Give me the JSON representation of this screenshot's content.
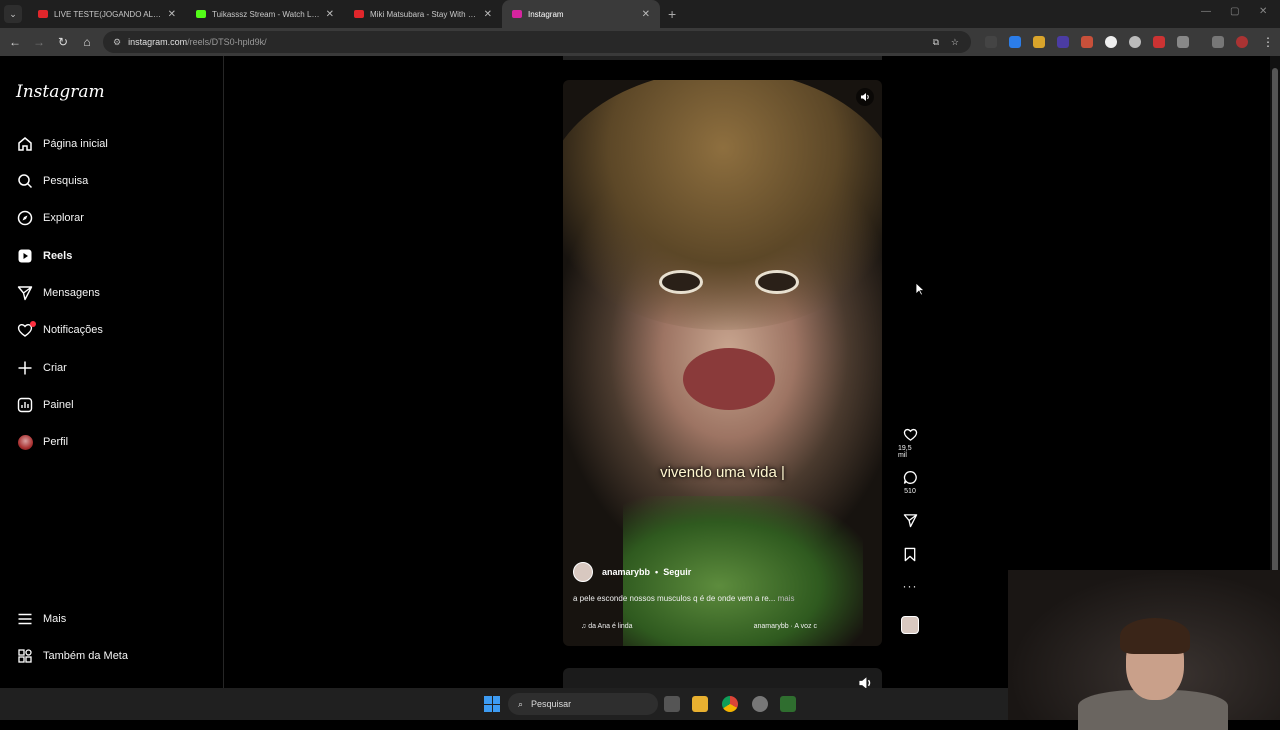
{
  "browser": {
    "tabs": [
      {
        "title": "LIVE TESTE(JOGANDO ALGO) -",
        "favicon_color": "#e0262b",
        "active": false
      },
      {
        "title": "Tuikasssz Stream - Watch Live o",
        "favicon_color": "#53fc18",
        "active": false
      },
      {
        "title": "Miki Matsubara - Stay With Me",
        "favicon_color": "#e0262b",
        "active": false
      },
      {
        "title": "Instagram",
        "favicon_color": "#d6249f",
        "active": true
      }
    ],
    "close_glyph": "✕",
    "new_tab_glyph": "+",
    "url_host": "instagram.com",
    "url_path": "/reels/DTS0-hpld9k/"
  },
  "sidebar": {
    "logo": "Instagram",
    "items": [
      {
        "label": "Página inicial",
        "icon": "home-icon"
      },
      {
        "label": "Pesquisa",
        "icon": "search-icon"
      },
      {
        "label": "Explorar",
        "icon": "compass-icon"
      },
      {
        "label": "Reels",
        "icon": "reels-icon"
      },
      {
        "label": "Mensagens",
        "icon": "send-icon"
      },
      {
        "label": "Notificações",
        "icon": "heart-icon"
      },
      {
        "label": "Criar",
        "icon": "plus-icon"
      },
      {
        "label": "Painel",
        "icon": "chart-icon"
      },
      {
        "label": "Perfil",
        "icon": "avatar-icon"
      }
    ],
    "bottom_items": [
      {
        "label": "Mais",
        "icon": "menu-icon"
      },
      {
        "label": "Também da Meta",
        "icon": "meta-icon"
      }
    ]
  },
  "reel": {
    "subtitle": "vivendo uma vida |",
    "author": "anamarybb",
    "separator": "•",
    "follow_label": "Seguir",
    "caption": "a pele esconde nossos musculos q é de onde vem a re...",
    "caption_more": "mais",
    "audio_left": "da Ana é linda",
    "audio_right": "anamarybb · A voz c",
    "likes": "19,5 mil",
    "comments": "510"
  },
  "taskbar": {
    "search_placeholder": "Pesquisar"
  },
  "colors": {
    "instagram_bg": "#000000",
    "notification_dot": "#ff3040"
  }
}
